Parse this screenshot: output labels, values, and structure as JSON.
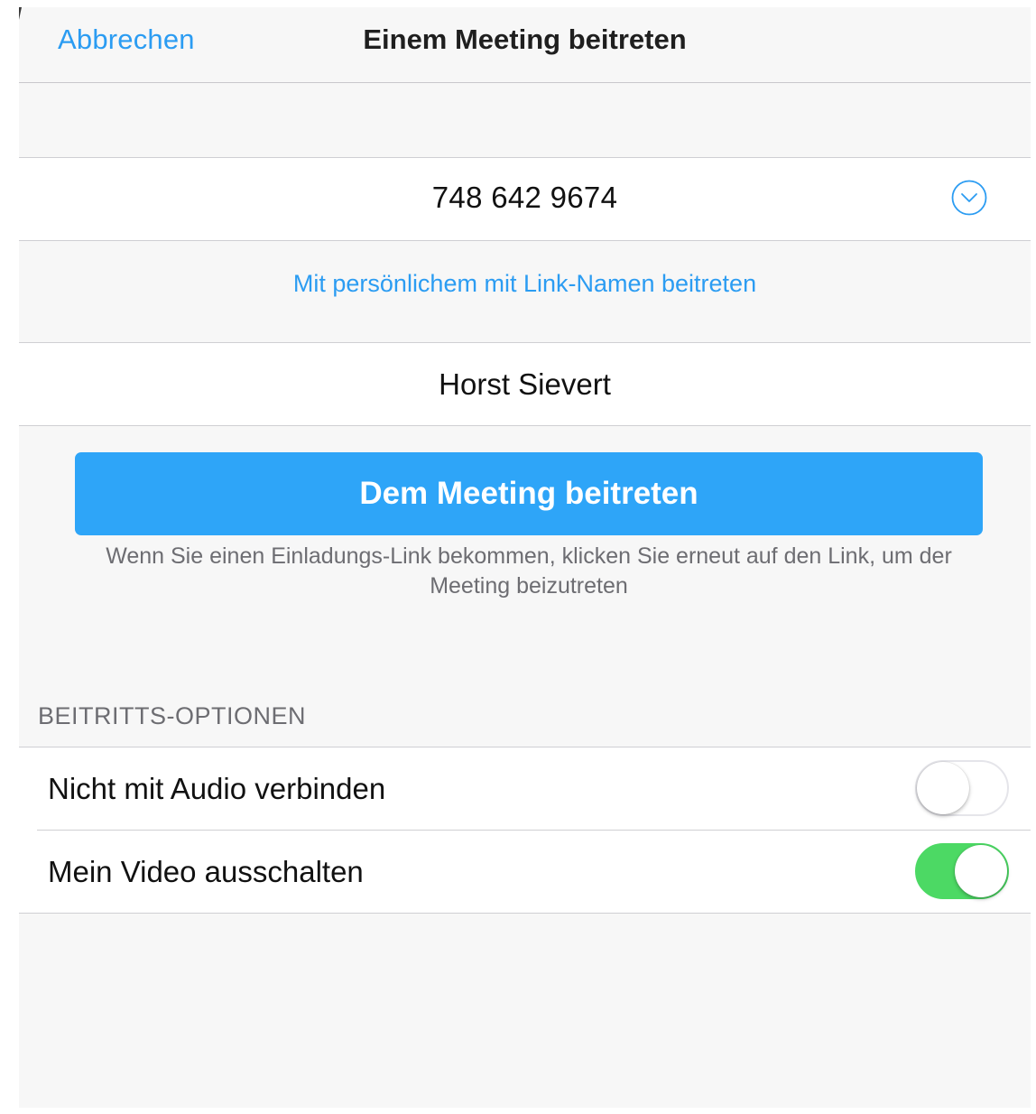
{
  "navbar": {
    "cancel_label": "Abbrechen",
    "title": "Einem Meeting beitreten"
  },
  "meeting": {
    "id": "748 642 9674",
    "dropdown_icon": "chevron-down-circle-icon"
  },
  "link_name": {
    "label": "Mit persönlichem mit Link-Namen beitreten"
  },
  "user": {
    "name": "Horst Sievert"
  },
  "join_button": {
    "label": "Dem Meeting beitreten",
    "color": "#2ea5f8"
  },
  "hint": {
    "text": "Wenn Sie einen Einladungs-Link bekommen, klicken Sie erneut auf den Link, um der Meeting beizutreten"
  },
  "options": {
    "header": "BEITRITTS-OPTIONEN",
    "items": [
      {
        "label": "Nicht mit Audio verbinden",
        "enabled": false
      },
      {
        "label": "Mein Video ausschalten",
        "enabled": true
      }
    ]
  },
  "colors": {
    "accent": "#2b9cf2",
    "toggle_on": "#4cd964",
    "background": "#f7f7f7"
  }
}
